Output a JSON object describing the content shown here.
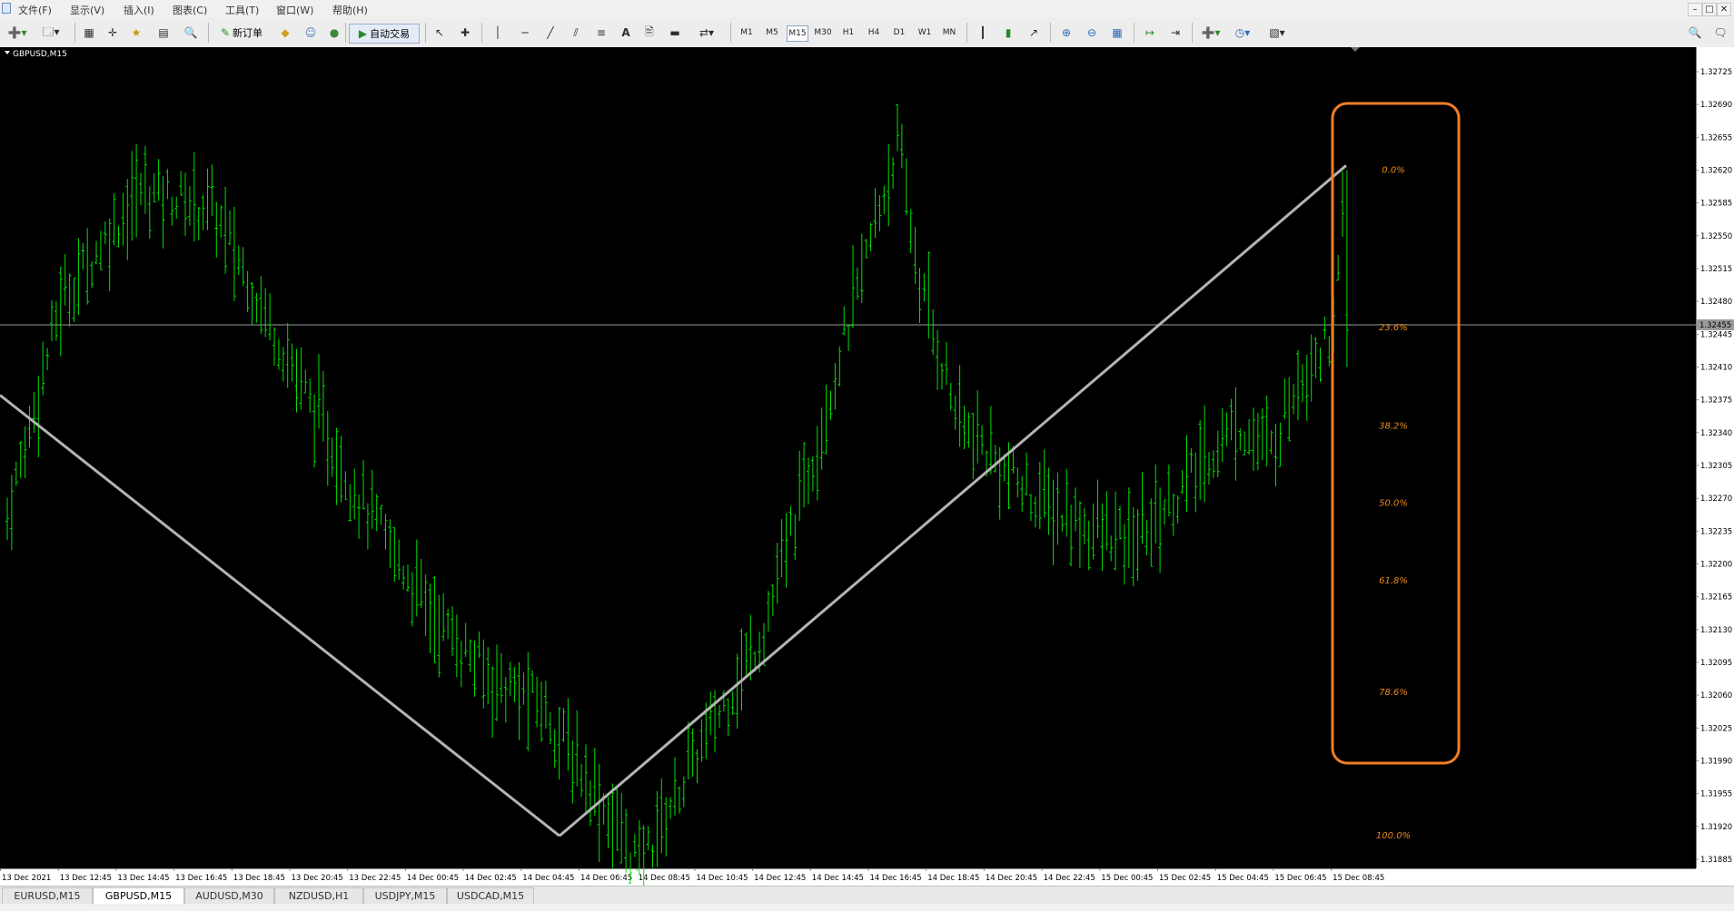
{
  "menu": [
    "文件(F)",
    "显示(V)",
    "插入(I)",
    "图表(C)",
    "工具(T)",
    "窗口(W)",
    "帮助(H)"
  ],
  "toolbar": {
    "new_order_label": "新订单",
    "auto_trading_label": "自动交易",
    "timeframes": [
      "M1",
      "M5",
      "M15",
      "M30",
      "H1",
      "H4",
      "D1",
      "W1",
      "MN"
    ],
    "active_timeframe": "M15"
  },
  "chart": {
    "symbol_label": "GBPUSD,M15",
    "background": "#000000",
    "candle_color": "#00e000",
    "fib_line_color": "#b4b4b4",
    "fib_text_color": "#e8891a",
    "highlight_color": "#f07d25",
    "current_price": "1.32455",
    "price_axis_labels": [
      "1.32725",
      "1.32690",
      "1.32655",
      "1.32620",
      "1.32585",
      "1.32550",
      "1.32515",
      "1.32480",
      "1.32445",
      "1.32410",
      "1.32375",
      "1.32340",
      "1.32305",
      "1.32270",
      "1.32235",
      "1.32200",
      "1.32165",
      "1.32130",
      "1.32095",
      "1.32060",
      "1.32025",
      "1.31990",
      "1.31955",
      "1.31920",
      "1.31885"
    ],
    "time_axis_labels": [
      "13 Dec 2021",
      "13 Dec 12:45",
      "13 Dec 14:45",
      "13 Dec 16:45",
      "13 Dec 18:45",
      "13 Dec 20:45",
      "13 Dec 22:45",
      "14 Dec 00:45",
      "14 Dec 02:45",
      "14 Dec 04:45",
      "14 Dec 06:45",
      "14 Dec 08:45",
      "14 Dec 10:45",
      "14 Dec 12:45",
      "14 Dec 14:45",
      "14 Dec 16:45",
      "14 Dec 18:45",
      "14 Dec 20:45",
      "14 Dec 22:45",
      "15 Dec 00:45",
      "15 Dec 02:45",
      "15 Dec 04:45",
      "15 Dec 06:45",
      "15 Dec 08:45"
    ],
    "fib_levels": [
      {
        "label": "0.0%",
        "price": 1.3262
      },
      {
        "label": "23.6%",
        "price": 1.32452
      },
      {
        "label": "38.2%",
        "price": 1.32347
      },
      {
        "label": "50.0%",
        "price": 1.32265
      },
      {
        "label": "61.8%",
        "price": 1.32182
      },
      {
        "label": "78.6%",
        "price": 1.32063
      },
      {
        "label": "100.0%",
        "price": 1.3191
      }
    ]
  },
  "tabs": [
    "EURUSD,M15",
    "GBPUSD,M15",
    "AUDUSD,M30",
    "NZDUSD,H1",
    "USDJPY,M15",
    "USDCAD,M15"
  ],
  "active_tab": "GBPUSD,M15"
}
